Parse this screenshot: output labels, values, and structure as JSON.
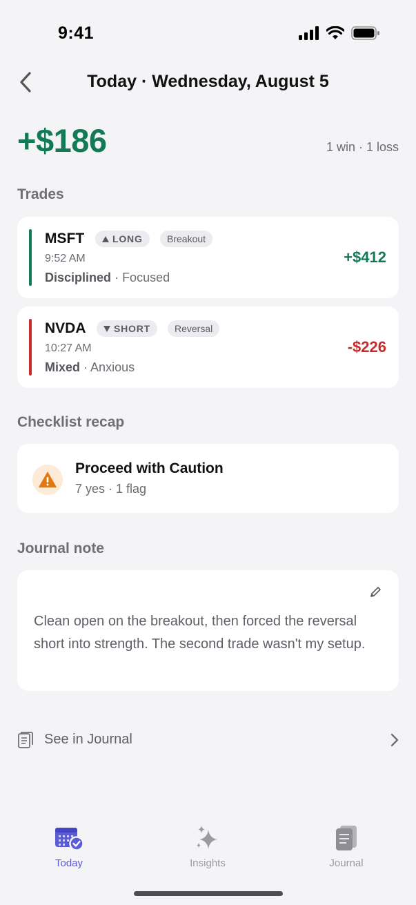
{
  "status_bar": {
    "time": "9:41"
  },
  "nav": {
    "title": "Today · Wednesday, August 5",
    "back_icon": "chevron-left-icon"
  },
  "summary": {
    "pnl": "+$186",
    "record": "1 win · 1 loss",
    "pnl_color": "#127a55"
  },
  "sections": {
    "trades": "Trades",
    "checklist": "Checklist recap",
    "journal": "Journal note"
  },
  "trades": [
    {
      "ticker": "MSFT",
      "direction": "LONG",
      "direction_icon": "triangle-up-icon",
      "setup": "Breakout",
      "time": "9:52 AM",
      "discipline": "Disciplined",
      "mood": "Focused",
      "separator": "·",
      "pnl": "+$412",
      "color": "#127a55"
    },
    {
      "ticker": "NVDA",
      "direction": "SHORT",
      "direction_icon": "triangle-down-icon",
      "setup": "Reversal",
      "time": "10:27 AM",
      "discipline": "Mixed",
      "mood": "Anxious",
      "separator": "·",
      "pnl": "-$226",
      "color": "#c92a2a"
    }
  ],
  "checklist": {
    "title": "Proceed with Caution",
    "summary": "7 yes · 1 flag",
    "icon": "warning-icon",
    "accent": "#e07a10"
  },
  "journal": {
    "text": "Clean open on the breakout, then forced the reversal short into strength. The second trade wasn't my setup.",
    "edit_icon": "pencil-icon"
  },
  "see_in_journal": {
    "label": "See in Journal",
    "icon": "document-icon"
  },
  "tabbar": {
    "tabs": [
      {
        "label": "Today",
        "icon": "calendar-check-icon",
        "active": true
      },
      {
        "label": "Insights",
        "icon": "sparkles-icon",
        "active": false
      },
      {
        "label": "Journal",
        "icon": "document-icon",
        "active": false
      }
    ],
    "active_color": "#5b5bd6",
    "inactive_color": "#9a9aa0"
  }
}
